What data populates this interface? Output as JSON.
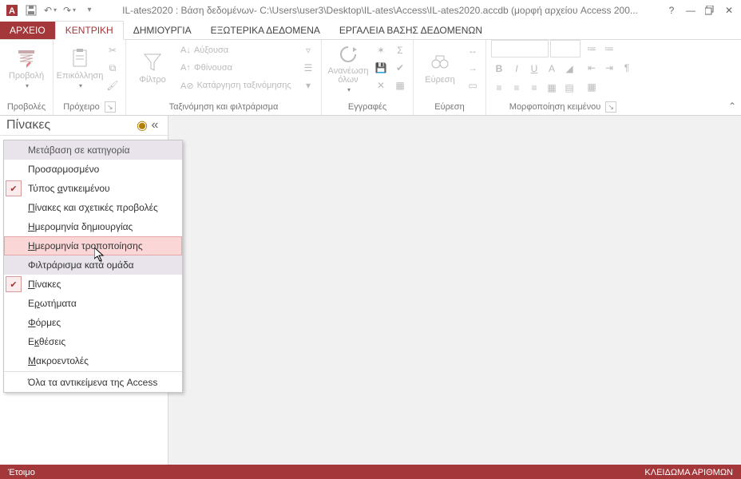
{
  "titlebar": {
    "title": "IL-ates2020 : Βάση δεδομένων- C:\\Users\\user3\\Desktop\\IL-ates\\Access\\IL-ates2020.accdb (μορφή αρχείου Access 200..."
  },
  "tabs": {
    "file": "ΑΡΧΕΙΟ",
    "home": "ΚΕΝΤΡΙΚΗ",
    "create": "ΔΗΜΙΟΥΡΓΙΑ",
    "external": "ΕΞΩΤΕΡΙΚΑ ΔΕΔΟΜΕΝΑ",
    "dbtools": "ΕΡΓΑΛΕΙΑ ΒΑΣΗΣ ΔΕΔΟΜΕΝΩΝ"
  },
  "ribbon": {
    "views": {
      "btn": "Προβολή",
      "label": "Προβολές"
    },
    "clipboard": {
      "paste": "Επικόλληση",
      "label": "Πρόχειρο"
    },
    "sort": {
      "filter": "Φίλτρο",
      "asc": "Αύξουσα",
      "desc": "Φθίνουσα",
      "clear": "Κατάργηση ταξινόμησης",
      "label": "Ταξινόμηση και φιλτράρισμα"
    },
    "records": {
      "refresh": "Ανανέωση όλων",
      "label": "Εγγραφές"
    },
    "find": {
      "btn": "Εύρεση",
      "label": "Εύρεση"
    },
    "textfmt": {
      "label": "Μορφοποίηση κειμένου"
    }
  },
  "navpane": {
    "title": "Πίνακες"
  },
  "menu": {
    "nav_category": "Μετάβαση σε κατηγορία",
    "custom": "Προσαρμοσμένο",
    "obj_type": "Τύπος αντικειμένου",
    "tables_views": "Πίνακες και σχετικές προβολές",
    "created": "Ημερομηνία δημιουργίας",
    "modified": "Ημερομηνία τροποποίησης",
    "filter_group": "Φιλτράρισμα κατά ομάδα",
    "tables": "Πίνακες",
    "queries": "Ερωτήματα",
    "forms": "Φόρμες",
    "reports": "Εκθέσεις",
    "macros": "Μακροεντολές",
    "all": "Όλα τα αντικείμενα της Access"
  },
  "status": {
    "ready": "Έτοιμο",
    "numlock": "ΚΛΕΙΔΩΜΑ ΑΡΙΘΜΩΝ"
  }
}
